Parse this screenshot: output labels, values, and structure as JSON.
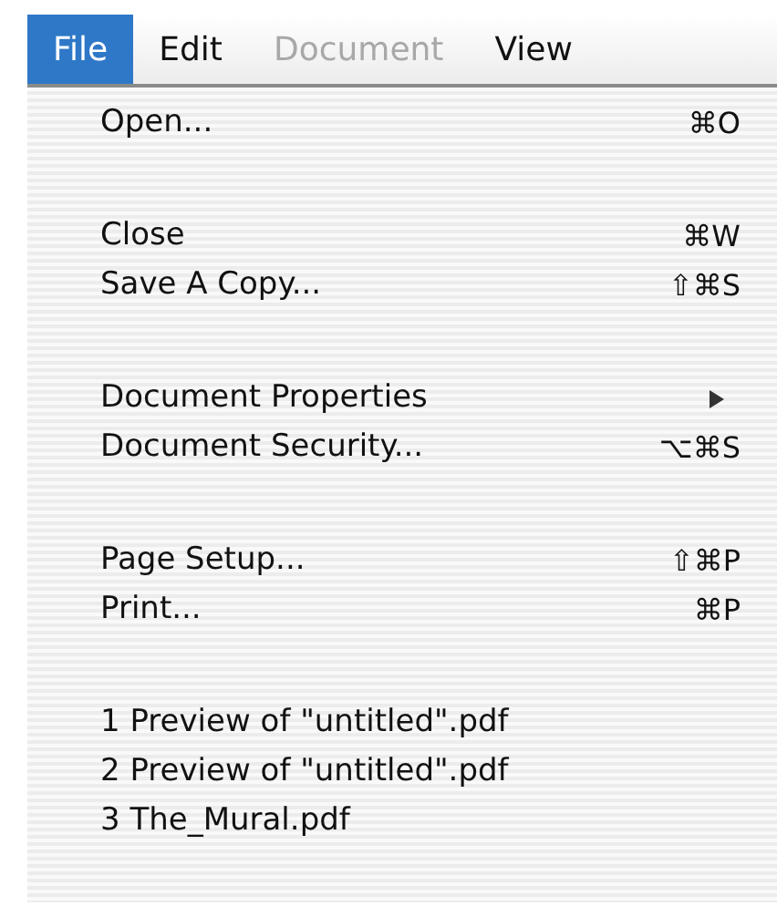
{
  "menubar": [
    {
      "label": "File",
      "selected": true,
      "disabled": false
    },
    {
      "label": "Edit",
      "selected": false,
      "disabled": false
    },
    {
      "label": "Document",
      "selected": false,
      "disabled": true
    },
    {
      "label": "View",
      "selected": false,
      "disabled": false
    }
  ],
  "menu": {
    "groups": [
      {
        "items": [
          {
            "kind": "command",
            "label": "Open...",
            "shortcut": "⌘O"
          }
        ]
      },
      {
        "items": [
          {
            "kind": "command",
            "label": "Close",
            "shortcut": "⌘W"
          },
          {
            "kind": "command",
            "label": "Save A Copy...",
            "shortcut": "⇧⌘S"
          }
        ]
      },
      {
        "items": [
          {
            "kind": "submenu",
            "label": "Document Properties"
          },
          {
            "kind": "command",
            "label": "Document Security...",
            "shortcut": "⌥⌘S"
          }
        ]
      },
      {
        "items": [
          {
            "kind": "command",
            "label": "Page Setup...",
            "shortcut": "⇧⌘P"
          },
          {
            "kind": "command",
            "label": "Print...",
            "shortcut": "⌘P"
          }
        ]
      },
      {
        "items": [
          {
            "kind": "command",
            "label": "1 Preview of \"untitled\".pdf"
          },
          {
            "kind": "command",
            "label": "2 Preview of \"untitled\".pdf"
          },
          {
            "kind": "command",
            "label": "3 The_Mural.pdf"
          }
        ]
      }
    ]
  }
}
